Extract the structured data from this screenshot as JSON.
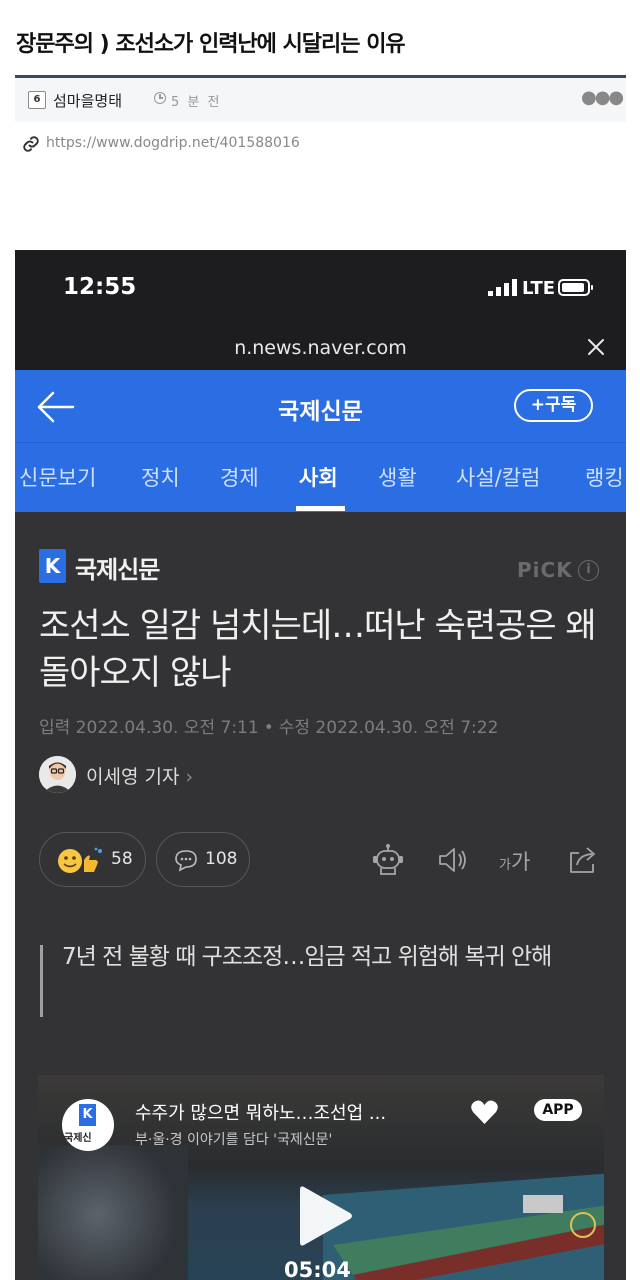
{
  "post": {
    "title": "장문주의 ) 조선소가 인력난에 시달리는 이유",
    "author_badge": "6",
    "author": "섬마을명태",
    "time": "5 분 전",
    "link": "https://www.dogdrip.net/401588016"
  },
  "phone": {
    "time": "12:55",
    "network": "LTE",
    "url": "n.news.naver.com"
  },
  "naver": {
    "press": "국제신문",
    "subscribe": "구독",
    "tabs": [
      "신문보기",
      "정치",
      "경제",
      "사회",
      "생활",
      "사설/칼럼",
      "랭킹"
    ],
    "active_tab": "사회"
  },
  "article": {
    "press_logo_letter": "K",
    "press_logo_name": "국제신문",
    "pick": "PiCK",
    "headline": "조선소 일감 넘치는데…떠난 숙련공은 왜 돌아오지 않나",
    "input_date": "입력 2022.04.30. 오전 7:11",
    "edit_date": "수정 2022.04.30. 오전 7:22",
    "reporter": "이세영 기자",
    "reaction_count": "58",
    "comment_count": "108",
    "font_icon_small": "가",
    "font_icon_large": "가",
    "subheadline": "7년 전 불황 때 구조조정…임금 적고 위험해 복귀 안해"
  },
  "video": {
    "channel_logo_name": "국제신",
    "title": "수주가 많으면 뭐하노…조선업 ...",
    "subtitle": "부·울·경 이야기를 담다 '국제신문'",
    "app_badge": "APP",
    "duration": "05:04"
  },
  "colors": {
    "naver_blue": "#2b6de3",
    "article_bg": "#333335",
    "divider": "#374a5e"
  }
}
